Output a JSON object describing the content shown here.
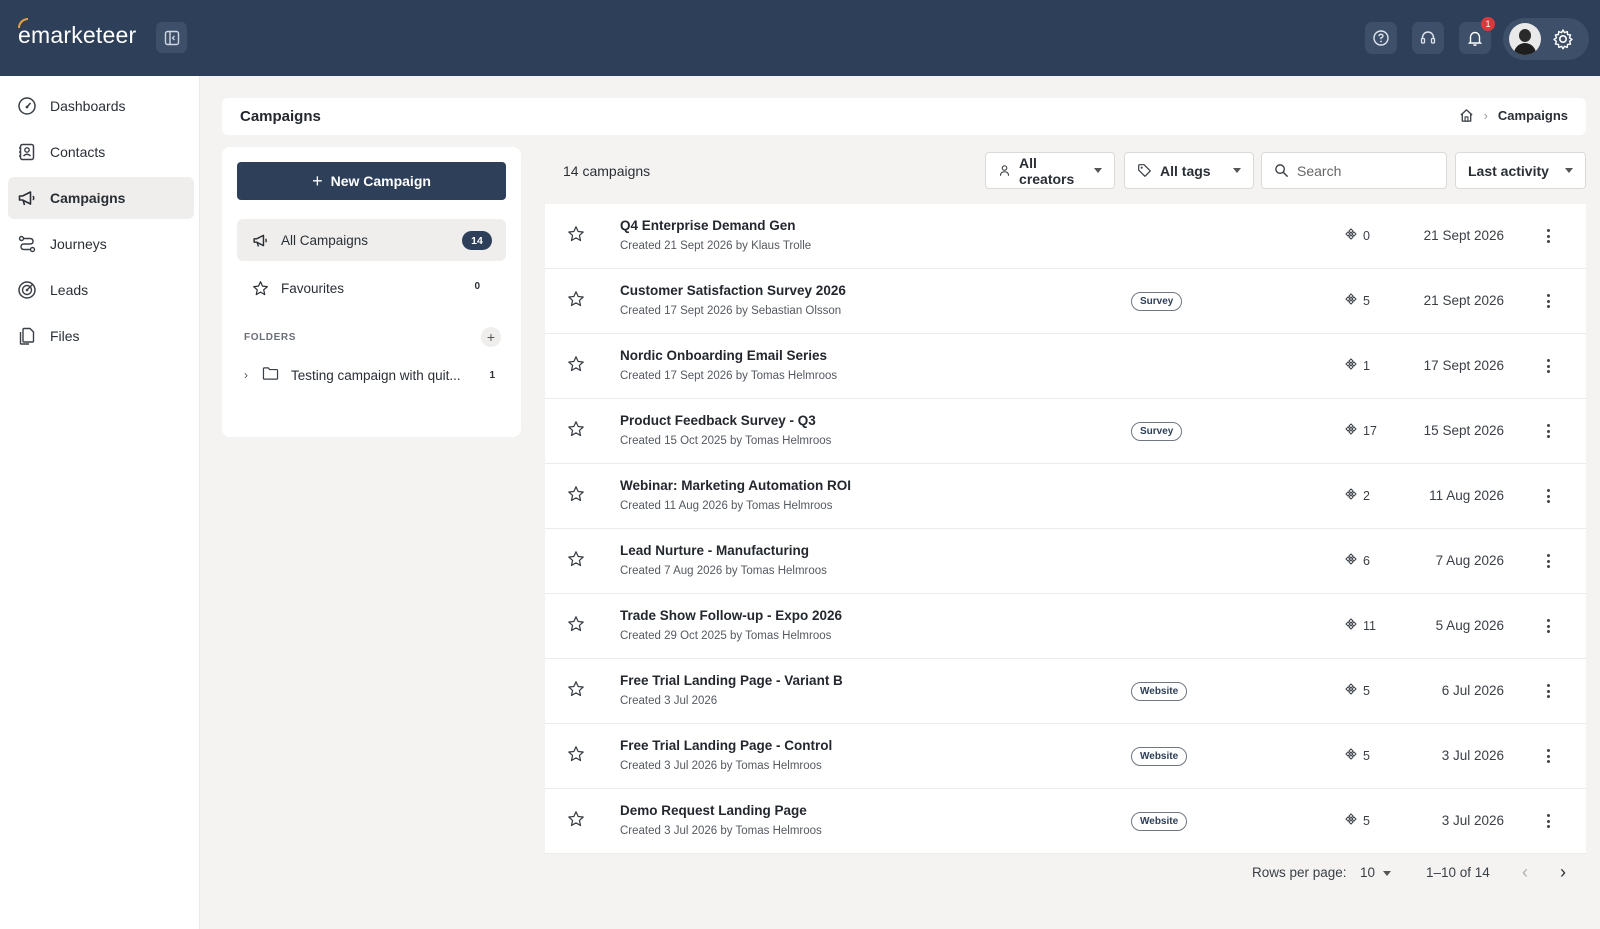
{
  "header": {
    "logo_text": "emarketeer",
    "notification_count": "1",
    "icons": [
      "sidebar-toggle-icon",
      "help-icon",
      "headset-icon",
      "bell-icon",
      "avatar",
      "gear-icon"
    ]
  },
  "sidebar": {
    "items": [
      {
        "label": "Dashboards",
        "icon": "dashboard-icon"
      },
      {
        "label": "Contacts",
        "icon": "contacts-icon"
      },
      {
        "label": "Campaigns",
        "icon": "megaphone-icon",
        "active": true
      },
      {
        "label": "Journeys",
        "icon": "journey-icon"
      },
      {
        "label": "Leads",
        "icon": "target-icon"
      },
      {
        "label": "Files",
        "icon": "files-icon"
      }
    ]
  },
  "page": {
    "title": "Campaigns",
    "breadcrumb": "Campaigns"
  },
  "left_panel": {
    "new_campaign_label": "New Campaign",
    "all_campaigns_label": "All Campaigns",
    "all_campaigns_count": "14",
    "favourites_label": "Favourites",
    "favourites_count": "0",
    "folders_label": "FOLDERS",
    "folders": [
      {
        "name": "Testing campaign with quit...",
        "count": "1"
      }
    ]
  },
  "toolbar": {
    "count_text": "14 campaigns",
    "creators_filter": "All creators",
    "tags_filter": "All tags",
    "search_placeholder": "Search",
    "sort": "Last activity"
  },
  "campaigns": [
    {
      "name": "Q4 Enterprise Demand Gen",
      "meta": "Created 21 Sept 2026 by Klaus Trolle",
      "tag": "",
      "channels": "0",
      "date": "21 Sept 2026"
    },
    {
      "name": "Customer Satisfaction Survey 2026",
      "meta": "Created 17 Sept 2026 by Sebastian Olsson",
      "tag": "Survey",
      "channels": "5",
      "date": "21 Sept 2026"
    },
    {
      "name": "Nordic Onboarding Email Series",
      "meta": "Created 17 Sept 2026 by Tomas Helmroos",
      "tag": "",
      "channels": "1",
      "date": "17 Sept 2026"
    },
    {
      "name": "Product Feedback Survey - Q3",
      "meta": "Created 15 Oct 2025 by Tomas Helmroos",
      "tag": "Survey",
      "channels": "17",
      "date": "15 Sept 2026"
    },
    {
      "name": "Webinar: Marketing Automation ROI",
      "meta": "Created 11 Aug 2026 by Tomas Helmroos",
      "tag": "",
      "channels": "2",
      "date": "11 Aug 2026"
    },
    {
      "name": "Lead Nurture - Manufacturing",
      "meta": "Created 7 Aug 2026 by Tomas Helmroos",
      "tag": "",
      "channels": "6",
      "date": "7 Aug 2026"
    },
    {
      "name": "Trade Show Follow-up - Expo 2026",
      "meta": "Created 29 Oct 2025 by Tomas Helmroos",
      "tag": "",
      "channels": "11",
      "date": "5 Aug 2026"
    },
    {
      "name": "Free Trial Landing Page - Variant B",
      "meta": "Created 3 Jul 2026",
      "tag": "Website",
      "channels": "5",
      "date": "6 Jul 2026"
    },
    {
      "name": "Free Trial Landing Page - Control",
      "meta": "Created 3 Jul 2026 by Tomas Helmroos",
      "tag": "Website",
      "channels": "5",
      "date": "3 Jul 2026"
    },
    {
      "name": "Demo Request Landing Page",
      "meta": "Created 3 Jul 2026 by Tomas Helmroos",
      "tag": "Website",
      "channels": "5",
      "date": "3 Jul 2026"
    }
  ],
  "pagination": {
    "rows_label": "Rows per page:",
    "rows_value": "10",
    "range": "1–10 of 14"
  },
  "colors": {
    "topbar": "#2e3f5a",
    "primary_button": "#2e3f5a",
    "background": "#f4f3f1",
    "notification": "#d63b3b"
  }
}
